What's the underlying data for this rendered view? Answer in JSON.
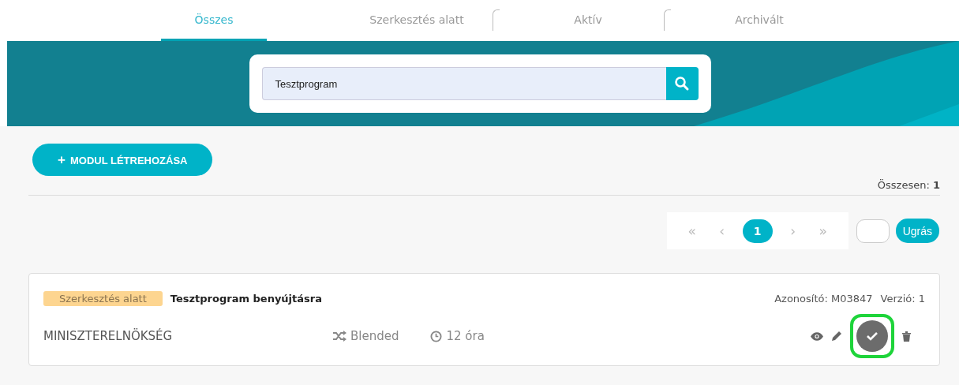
{
  "tabs": [
    {
      "label": "Összes",
      "selected": true
    },
    {
      "label": "Szerkesztés alatt",
      "selected": false
    },
    {
      "label": "Aktív",
      "selected": false
    },
    {
      "label": "Archivált",
      "selected": false
    }
  ],
  "search": {
    "value": "Tesztprogram"
  },
  "create_button": {
    "icon": "+",
    "label": "MODUL LÉTREHOZÁSA"
  },
  "total": {
    "label": "Összesen:",
    "value": "1"
  },
  "pagination": {
    "pages": [
      {
        "label": "«",
        "kind": "nav",
        "selected": false
      },
      {
        "label": "‹",
        "kind": "nav",
        "selected": false
      },
      {
        "label": "1",
        "kind": "page",
        "selected": true
      },
      {
        "label": "›",
        "kind": "nav",
        "selected": false
      },
      {
        "label": "»",
        "kind": "nav",
        "selected": false
      }
    ],
    "jump_button": "Ugrás"
  },
  "modules": [
    {
      "status": "Szerkesztés alatt",
      "title": "Tesztprogram benyújtásra",
      "id_label": "Azonosító: M03847",
      "version_label": "Verzió: 1",
      "organization": "MINISZTERELNÖKSÉG",
      "format": "Blended",
      "duration": "12 óra",
      "actions": [
        {
          "kind": "view",
          "highlighted": false
        },
        {
          "kind": "edit",
          "highlighted": false
        },
        {
          "kind": "approve",
          "highlighted": true
        },
        {
          "kind": "delete",
          "highlighted": false
        }
      ]
    }
  ]
}
